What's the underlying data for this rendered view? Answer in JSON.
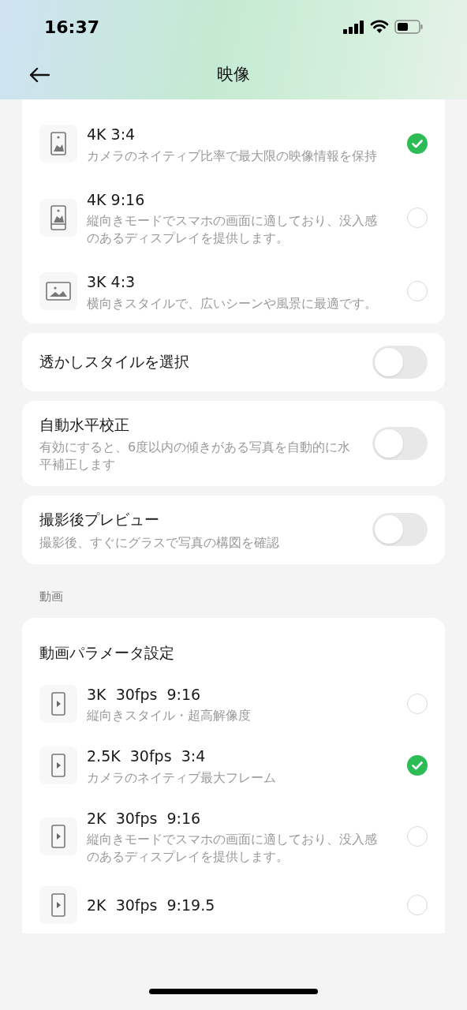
{
  "status_bar": {
    "time": "16:37"
  },
  "header": {
    "title": "映像"
  },
  "photo_options": [
    {
      "kind": "portrait",
      "title": "4K 3:4",
      "description": "カメラのネイティブ比率で最大限の映像情報を保持",
      "selected": true
    },
    {
      "kind": "tall",
      "title": "4K 9:16",
      "description": "縦向きモードでスマホの画面に適しており、没入感のあるディスプレイを提供します。",
      "selected": false
    },
    {
      "kind": "landscape",
      "title": "3K 4:3",
      "description": "横向きスタイルで、広いシーンや風景に最適です。",
      "selected": false
    }
  ],
  "toggles": [
    {
      "label": "透かしスタイルを選択",
      "on": false
    },
    {
      "label": "自動水平校正",
      "description": "有効にすると、6度以内の傾きがある写真を自動的に水平補正します",
      "on": false
    },
    {
      "label": "撮影後プレビュー",
      "description": "撮影後、すぐにグラスで写真の構図を確認",
      "on": false
    }
  ],
  "video_section": {
    "label": "動画",
    "title": "動画パラメータ設定",
    "options": [
      {
        "title": "3K  30fps  9:16",
        "description": "縦向きスタイル・超高解像度",
        "selected": false
      },
      {
        "title": "2.5K  30fps  3:4",
        "description": "カメラのネイティブ最大フレーム",
        "selected": true
      },
      {
        "title": "2K  30fps  9:16",
        "description": "縦向きモードでスマホの画面に適しており、没入感のあるディスプレイを提供します。",
        "selected": false
      },
      {
        "title": "2K  30fps  9:19.5",
        "selected": false
      }
    ]
  }
}
